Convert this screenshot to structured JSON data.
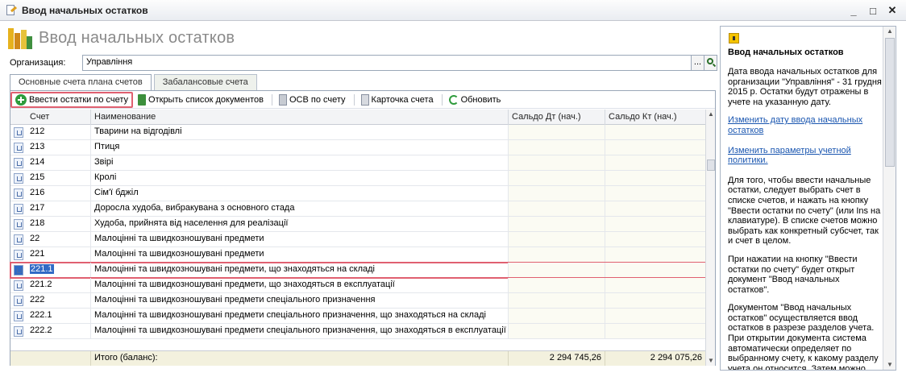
{
  "window": {
    "title": "Ввод начальных остатков",
    "controls": [
      "_",
      "□",
      "✕"
    ]
  },
  "page_title": "Ввод начальных остатков",
  "organization": {
    "label": "Организация:",
    "value": "Управління",
    "select_btn": "..."
  },
  "tabs": [
    {
      "label": "Основные счета плана счетов",
      "active": true
    },
    {
      "label": "Забалансовые счета",
      "active": false
    }
  ],
  "toolbar": {
    "enter_balances": "Ввести остатки по счету",
    "open_doc_list": "Открыть список документов",
    "osv": "ОСВ по счету",
    "account_card": "Карточка счета",
    "refresh": "Обновить"
  },
  "table": {
    "columns": [
      "Счет",
      "Наименование",
      "Сальдо Дт (нач.)",
      "Сальдо Кт (нач.)"
    ],
    "rows": [
      {
        "code": "212",
        "name": "Тварини на відгодівлі"
      },
      {
        "code": "213",
        "name": "Птиця"
      },
      {
        "code": "214",
        "name": "Звірі"
      },
      {
        "code": "215",
        "name": "Кролі"
      },
      {
        "code": "216",
        "name": "Сім'ї бджіл"
      },
      {
        "code": "217",
        "name": "Доросла худоба, вибракувана з основного стада"
      },
      {
        "code": "218",
        "name": "Худоба, прийнята від населення для реалізації"
      },
      {
        "code": "22",
        "name": "Малоцінні та швидкозношувані предмети"
      },
      {
        "code": "221",
        "name": "Малоцінні та швидкозношувані предмети"
      },
      {
        "code": "221.1",
        "name": "Малоцінні та швидкозношувані предмети, що знаходяться на складі",
        "selected": true
      },
      {
        "code": "221.2",
        "name": "Малоцінні та швидкозношувані предмети, що знаходяться в експлуатації"
      },
      {
        "code": "222",
        "name": "Малоцінні та швидкозношувані предмети спеціального призначення"
      },
      {
        "code": "222.1",
        "name": "Малоцінні та швидкозношувані предмети спеціального призначення, що знаходяться на складі"
      },
      {
        "code": "222.2",
        "name": "Малоцінні та швидкозношувані предмети спеціального призначення, що знаходяться в експлуатації"
      }
    ],
    "footer": {
      "label": "Итого (баланс):",
      "total_dt": "2 294 745,26",
      "total_kt": "2 294 075,26"
    }
  },
  "help": {
    "title": "Ввод начальных остатков",
    "p1": "Дата ввода начальных остатков для организации \"Управління\" - 31 грудня 2015 р. Остатки будут отражены в учете на указанную дату.",
    "link1": "Изменить дату ввода начальных остатков",
    "link2": "Изменить параметры учетной политики.",
    "p2": "Для того, чтобы ввести начальные остатки, следует выбрать счет в списке счетов, и нажать на кнопку \"Ввести остатки по счету\" (или Ins на клавиатуре). В списке счетов можно выбрать как конкретный субсчет, так и счет в целом.",
    "p3": "При нажатии на кнопку \"Ввести остатки по счету\" будет открыт документ \"Ввод начальных остатков\".",
    "p4": "Документом \"Ввод начальных остатков\" осуществляется ввод остатков в разрезе разделов учета. При открытии документа система автоматически определяет по выбранному счету, к какому разделу учета он относится. Затем можно"
  }
}
